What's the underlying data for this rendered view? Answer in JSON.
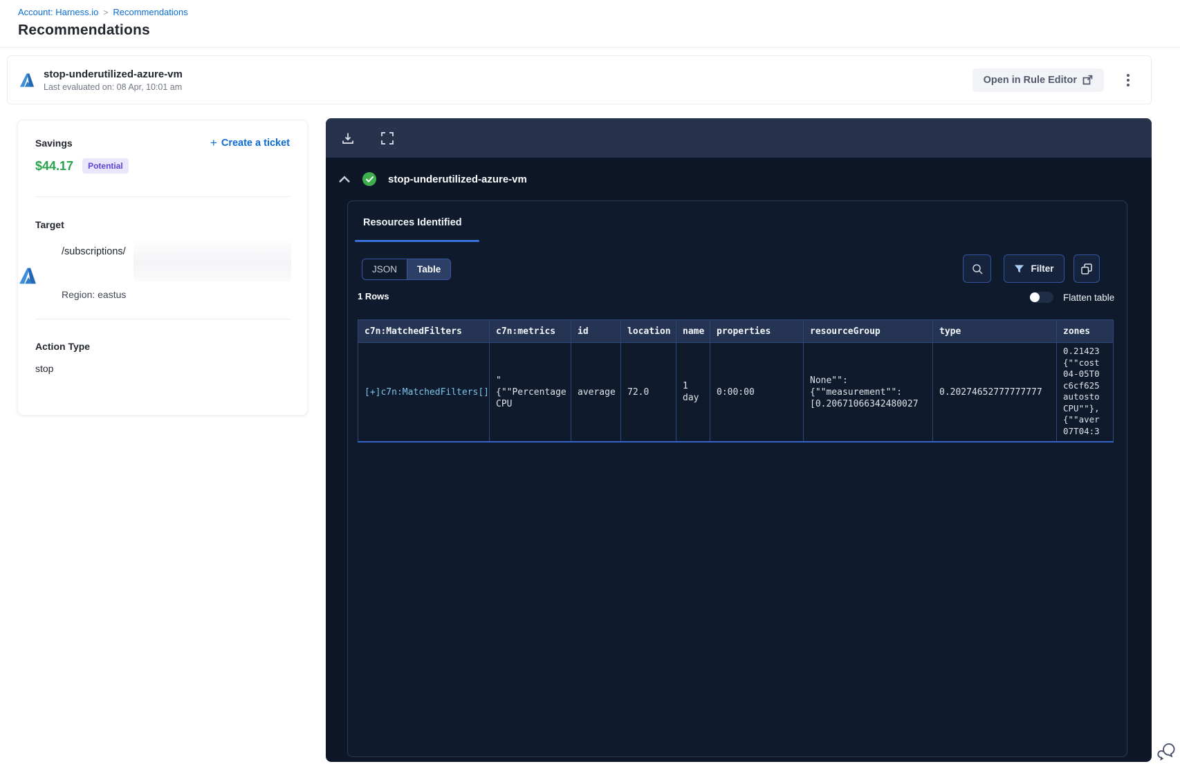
{
  "breadcrumb": {
    "account": "Account: Harness.io",
    "separator": ">",
    "current": "Recommendations"
  },
  "page": {
    "title": "Recommendations"
  },
  "header_card": {
    "title": "stop-underutilized-azure-vm",
    "subtitle": "Last evaluated on: 08 Apr, 10:01 am",
    "open_rule_editor_label": "Open in Rule Editor"
  },
  "sidebar": {
    "savings_label": "Savings",
    "savings_amount": "$44.17",
    "savings_badge": "Potential",
    "create_ticket_label": "Create a ticket",
    "create_ticket_plus": "+",
    "target_label": "Target",
    "target_path": "/subscriptions/",
    "region": "Region: eastus",
    "action_type_label": "Action Type",
    "action_type_value": "stop"
  },
  "panel": {
    "title": "stop-underutilized-azure-vm",
    "tab_label": "Resources Identified",
    "view_toggle": {
      "json_label": "JSON",
      "table_label": "Table",
      "active": "Table"
    },
    "filter_label": "Filter",
    "rows_count": "1 Rows",
    "flatten_label": "Flatten table",
    "table": {
      "columns": [
        "c7n:MatchedFilters",
        "c7n:metrics",
        "id",
        "location",
        "name",
        "properties",
        "resourceGroup",
        "type",
        "zones"
      ],
      "cells": [
        "[+]c7n:MatchedFilters[]",
        "\"\n{\"\"Percentage\nCPU",
        "average",
        "72.0",
        "1\nday",
        "0:00:00",
        "None\"\":\n{\"\"measurement\"\":\n[0.20671066342480027",
        "0.20274652777777777",
        "0.21423\n{\"\"cost\n04-05T0\nc6cf625\nautosto\nCPU\"\"},\n{\"\"aver\n07T04:3"
      ]
    }
  },
  "icons": {
    "azure-icon": "azure triangle logo",
    "download-icon": "download to tray",
    "fullscreen-icon": "expand corners",
    "collapse-icon": "chevron up",
    "check-circle-icon": "green success check",
    "search-icon": "magnifier",
    "filter-icon": "funnel",
    "copy-icon": "overlapping squares",
    "kebab-icon": "vertical three dots",
    "external-link-icon": "box with arrow",
    "chat-support-icon": "speech bubbles"
  },
  "colors": {
    "accent_blue": "#0a6cd6",
    "savings_green": "#2ba24d",
    "badge_purple_text": "#5a46d8",
    "badge_purple_bg": "#e9e5fb",
    "panel_body": "#0d1727",
    "panel_toolbar": "#27334d",
    "table_border": "#2c4878",
    "table_header_bg": "#243452",
    "row_bottom_line": "#3465c8",
    "link_cyan": "#7cc4e8",
    "success_green": "#3fae4c"
  }
}
